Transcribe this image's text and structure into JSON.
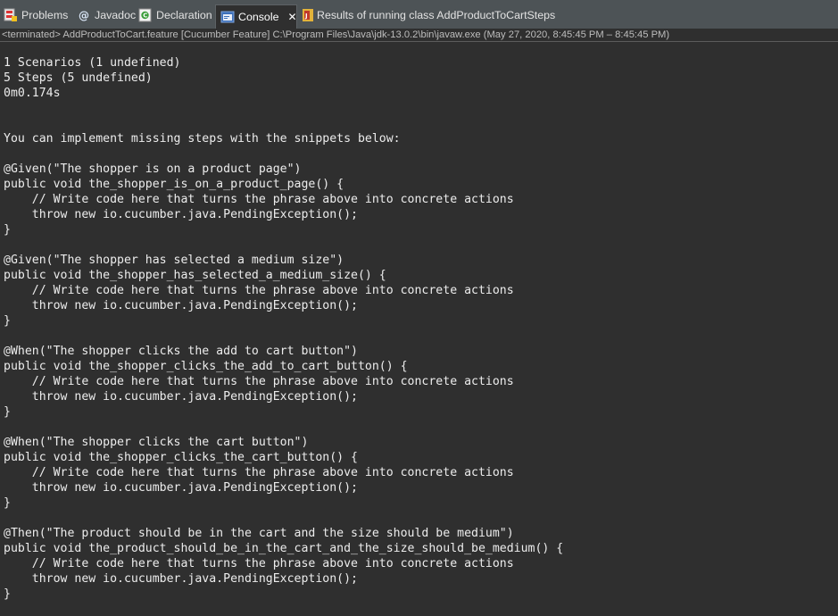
{
  "tabs": [
    {
      "label": "Problems",
      "icon": "problems-icon"
    },
    {
      "label": "Javadoc",
      "icon": "javadoc-icon"
    },
    {
      "label": "Declaration",
      "icon": "declaration-icon"
    },
    {
      "label": "Console",
      "icon": "console-icon",
      "active": true
    },
    {
      "label": "Results of running class AddProductToCartSteps",
      "icon": "junit-icon"
    }
  ],
  "close_symbol": "✕",
  "status_line": "<terminated> AddProductToCart.feature [Cucumber Feature] C:\\Program Files\\Java\\jdk-13.0.2\\bin\\javaw.exe  (May 27, 2020, 8:45:45 PM – 8:45:45 PM)",
  "console_lines": [
    "1 Scenarios (1 undefined)",
    "5 Steps (5 undefined)",
    "0m0.174s",
    "",
    "",
    "You can implement missing steps with the snippets below:",
    "",
    "@Given(\"The shopper is on a product page\")",
    "public void the_shopper_is_on_a_product_page() {",
    "    // Write code here that turns the phrase above into concrete actions",
    "    throw new io.cucumber.java.PendingException();",
    "}",
    "",
    "@Given(\"The shopper has selected a medium size\")",
    "public void the_shopper_has_selected_a_medium_size() {",
    "    // Write code here that turns the phrase above into concrete actions",
    "    throw new io.cucumber.java.PendingException();",
    "}",
    "",
    "@When(\"The shopper clicks the add to cart button\")",
    "public void the_shopper_clicks_the_add_to_cart_button() {",
    "    // Write code here that turns the phrase above into concrete actions",
    "    throw new io.cucumber.java.PendingException();",
    "}",
    "",
    "@When(\"The shopper clicks the cart button\")",
    "public void the_shopper_clicks_the_cart_button() {",
    "    // Write code here that turns the phrase above into concrete actions",
    "    throw new io.cucumber.java.PendingException();",
    "}",
    "",
    "@Then(\"The product should be in the cart and the size should be medium\")",
    "public void the_product_should_be_in_the_cart_and_the_size_should_be_medium() {",
    "    // Write code here that turns the phrase above into concrete actions",
    "    throw new io.cucumber.java.PendingException();",
    "}"
  ],
  "colors": {
    "background": "#2f2f2f",
    "tabbar": "#4d5356",
    "text": "#ececec",
    "status_text": "#bdbdbd"
  }
}
